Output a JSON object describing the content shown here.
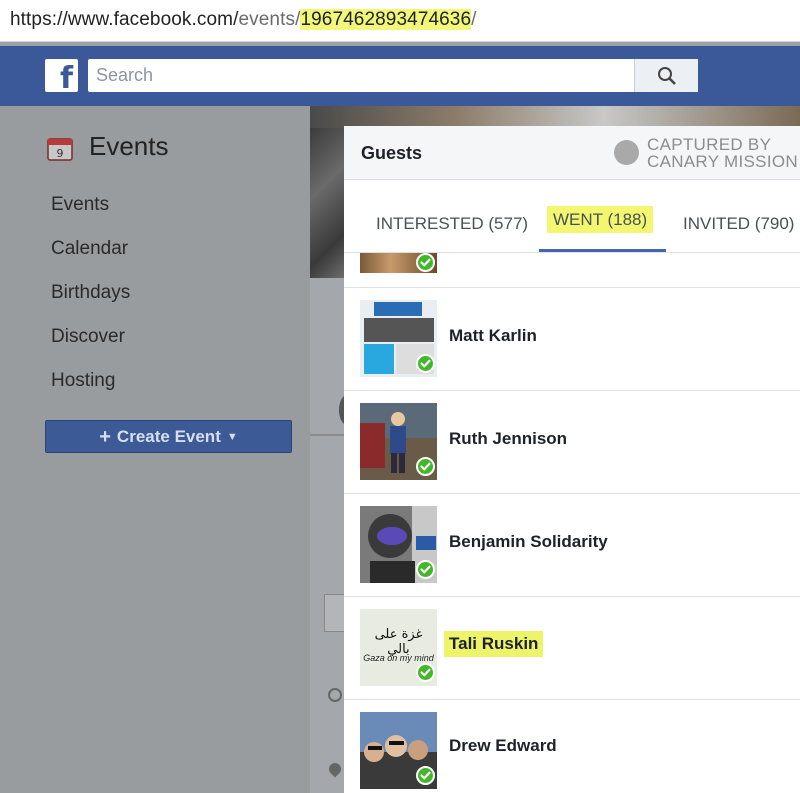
{
  "browser": {
    "url_prefix": "https://www.facebook.com/",
    "url_path": "events/",
    "url_id": "1967462893474636",
    "url_suffix": "/"
  },
  "header": {
    "logo": "f",
    "search_placeholder": "Search"
  },
  "sidebar": {
    "title": "Events",
    "items": [
      "Events",
      "Calendar",
      "Birthdays",
      "Discover",
      "Hosting"
    ],
    "create_button": "Create Event"
  },
  "modal": {
    "title": "Guests",
    "watermark_line1": "CAPTURED BY",
    "watermark_line2": "CANARY MISSION",
    "tabs": [
      {
        "label": "INTERESTED (577)"
      },
      {
        "label": "WENT (188)",
        "active": true
      },
      {
        "label": "INVITED (790)"
      }
    ],
    "guests": [
      {
        "name": ""
      },
      {
        "name": "Matt Karlin"
      },
      {
        "name": "Ruth Jennison"
      },
      {
        "name": "Benjamin Solidarity"
      },
      {
        "name": "Tali Ruskin",
        "highlighted": true
      },
      {
        "name": "Drew Edward"
      }
    ],
    "avatar_text": {
      "arabic": "غزة على بالي",
      "english": "Gaza on my mind"
    }
  },
  "colors": {
    "facebook_blue": "#3b5998",
    "highlight": "#f2f77a",
    "check_green": "#42b72a"
  }
}
